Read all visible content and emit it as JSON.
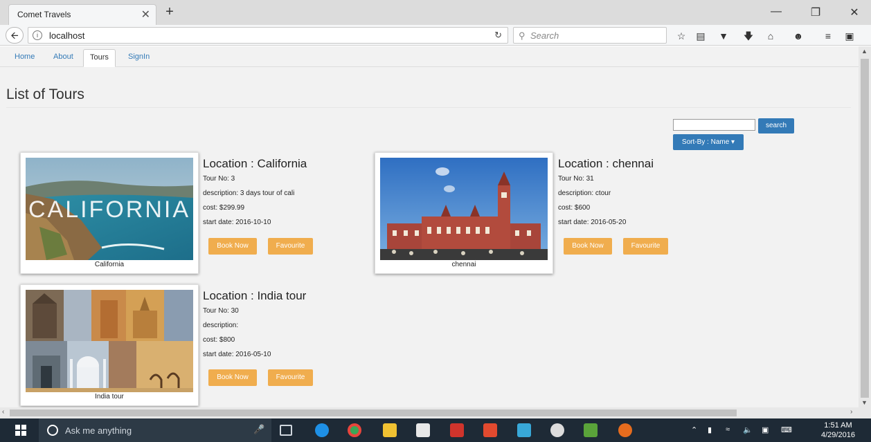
{
  "browser": {
    "tab_title": "Comet Travels",
    "tab_close": "✕",
    "new_tab": "+",
    "url": "localhost",
    "search_placeholder": "Search",
    "win_min": "—",
    "win_max": "❐",
    "win_close": "✕"
  },
  "site_nav": {
    "items": [
      {
        "label": "Home"
      },
      {
        "label": "About"
      },
      {
        "label": "Tours",
        "active": true
      },
      {
        "label": "SignIn"
      }
    ]
  },
  "page": {
    "title": "List of Tours",
    "search_value": "",
    "search_button": "search",
    "sort_button": "Sort-By : Name ▾"
  },
  "tours": [
    {
      "caption": "California",
      "location": "Location : California",
      "tour_no": "Tour No: 3",
      "description": "description: 3 days tour of cali",
      "cost": "cost: $299.99",
      "start_date": "start date: 2016-10-10",
      "image_overlay": "CALIFORNIA",
      "book_label": "Book Now",
      "fav_label": "Favourite"
    },
    {
      "caption": "chennai",
      "location": "Location : chennai",
      "tour_no": "Tour No: 31",
      "description": "description: ctour",
      "cost": "cost: $600",
      "start_date": "start date: 2016-05-20",
      "book_label": "Book Now",
      "fav_label": "Favourite"
    },
    {
      "caption": "India tour",
      "location": "Location : India tour",
      "tour_no": "Tour No: 30",
      "description": "description:",
      "cost": "cost: $800",
      "start_date": "start date: 2016-05-10",
      "book_label": "Book Now",
      "fav_label": "Favourite"
    }
  ],
  "taskbar": {
    "search_placeholder": "Ask me anything",
    "time": "1:51 AM",
    "date": "4/29/2016"
  },
  "colors": {
    "primary": "#337ab7",
    "warning": "#f0ad4e"
  }
}
